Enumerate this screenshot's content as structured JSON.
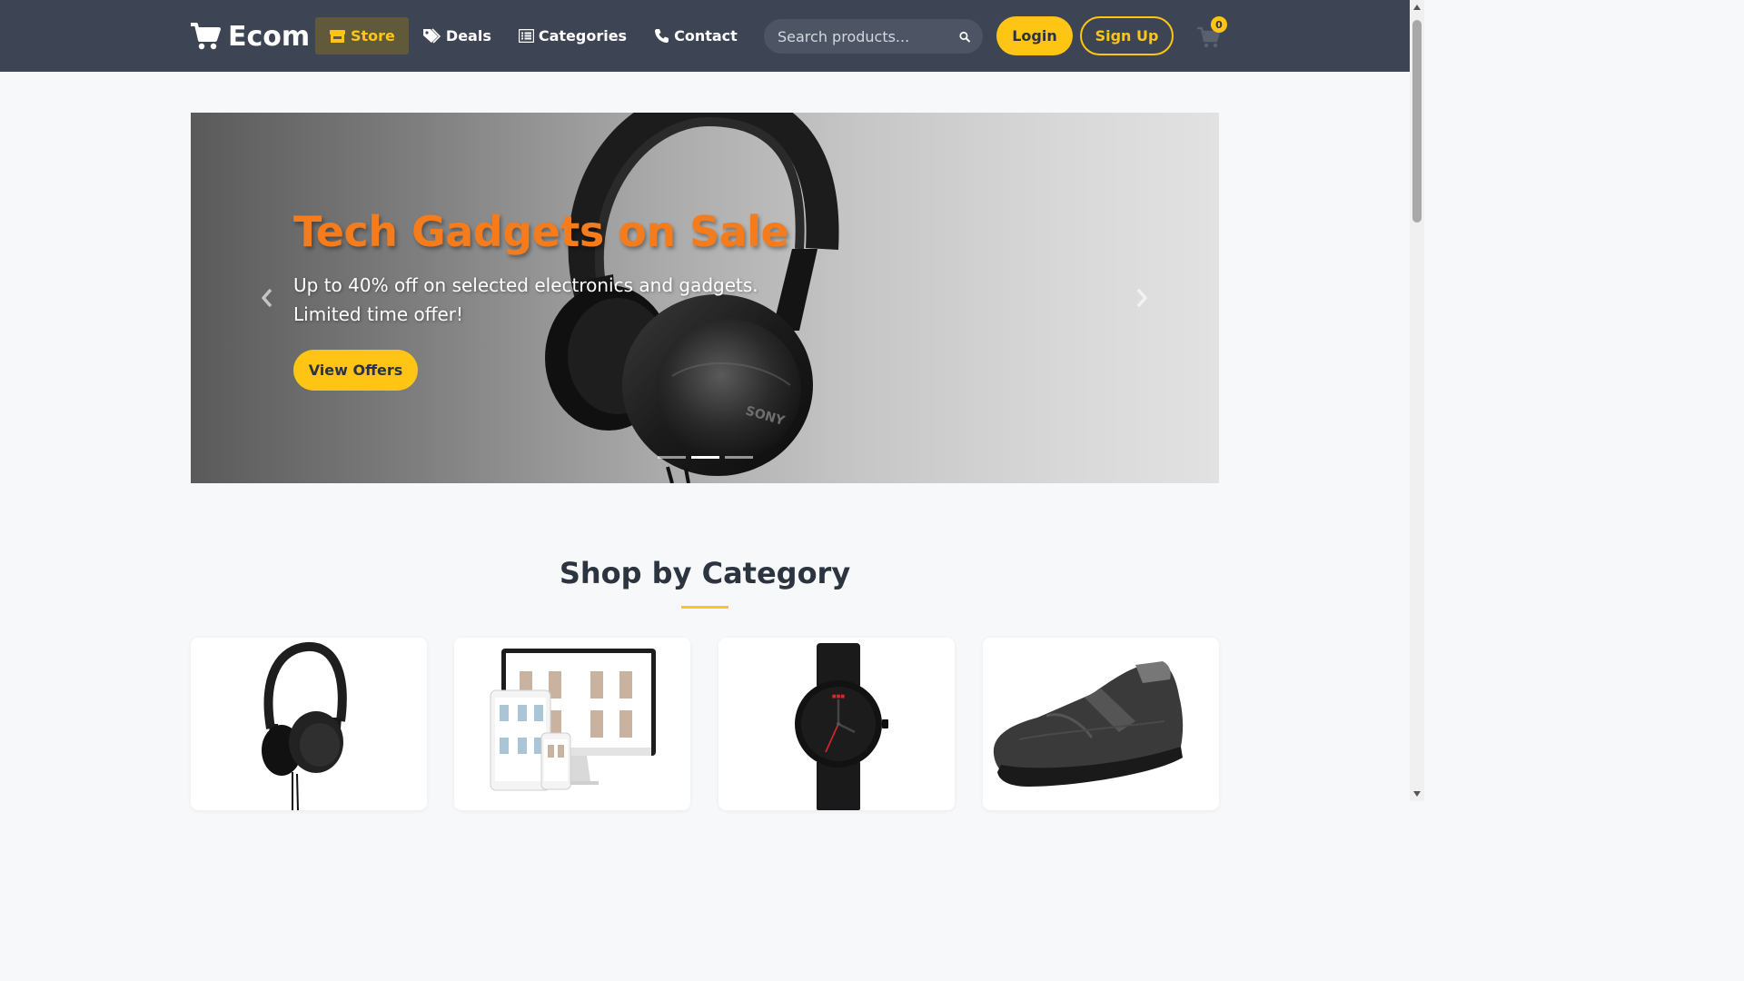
{
  "navbar": {
    "brand": "Ecom",
    "links": [
      {
        "label": "Store",
        "icon": "store-icon",
        "active": true
      },
      {
        "label": "Deals",
        "icon": "tags-icon",
        "active": false
      },
      {
        "label": "Categories",
        "icon": "list-icon",
        "active": false
      },
      {
        "label": "Contact",
        "icon": "phone-icon",
        "active": false
      }
    ],
    "search_placeholder": "Search products...",
    "login_label": "Login",
    "signup_label": "Sign Up",
    "cart_count": "0"
  },
  "hero": {
    "title": "Tech Gadgets on Sale",
    "text": "Up to 40% off on selected electronics and gadgets. Limited time offer!",
    "button_label": "View Offers",
    "product_brand": "SONY",
    "active_slide": 2,
    "slide_count": 3
  },
  "categories": {
    "title": "Shop by Category",
    "cards": [
      {
        "image": "headphones"
      },
      {
        "image": "devices-mockup"
      },
      {
        "image": "wristwatch"
      },
      {
        "image": "sneaker"
      }
    ]
  },
  "colors": {
    "accent": "#fec514",
    "navbar": "#3d4554",
    "hero_title": "#f47c1c"
  }
}
